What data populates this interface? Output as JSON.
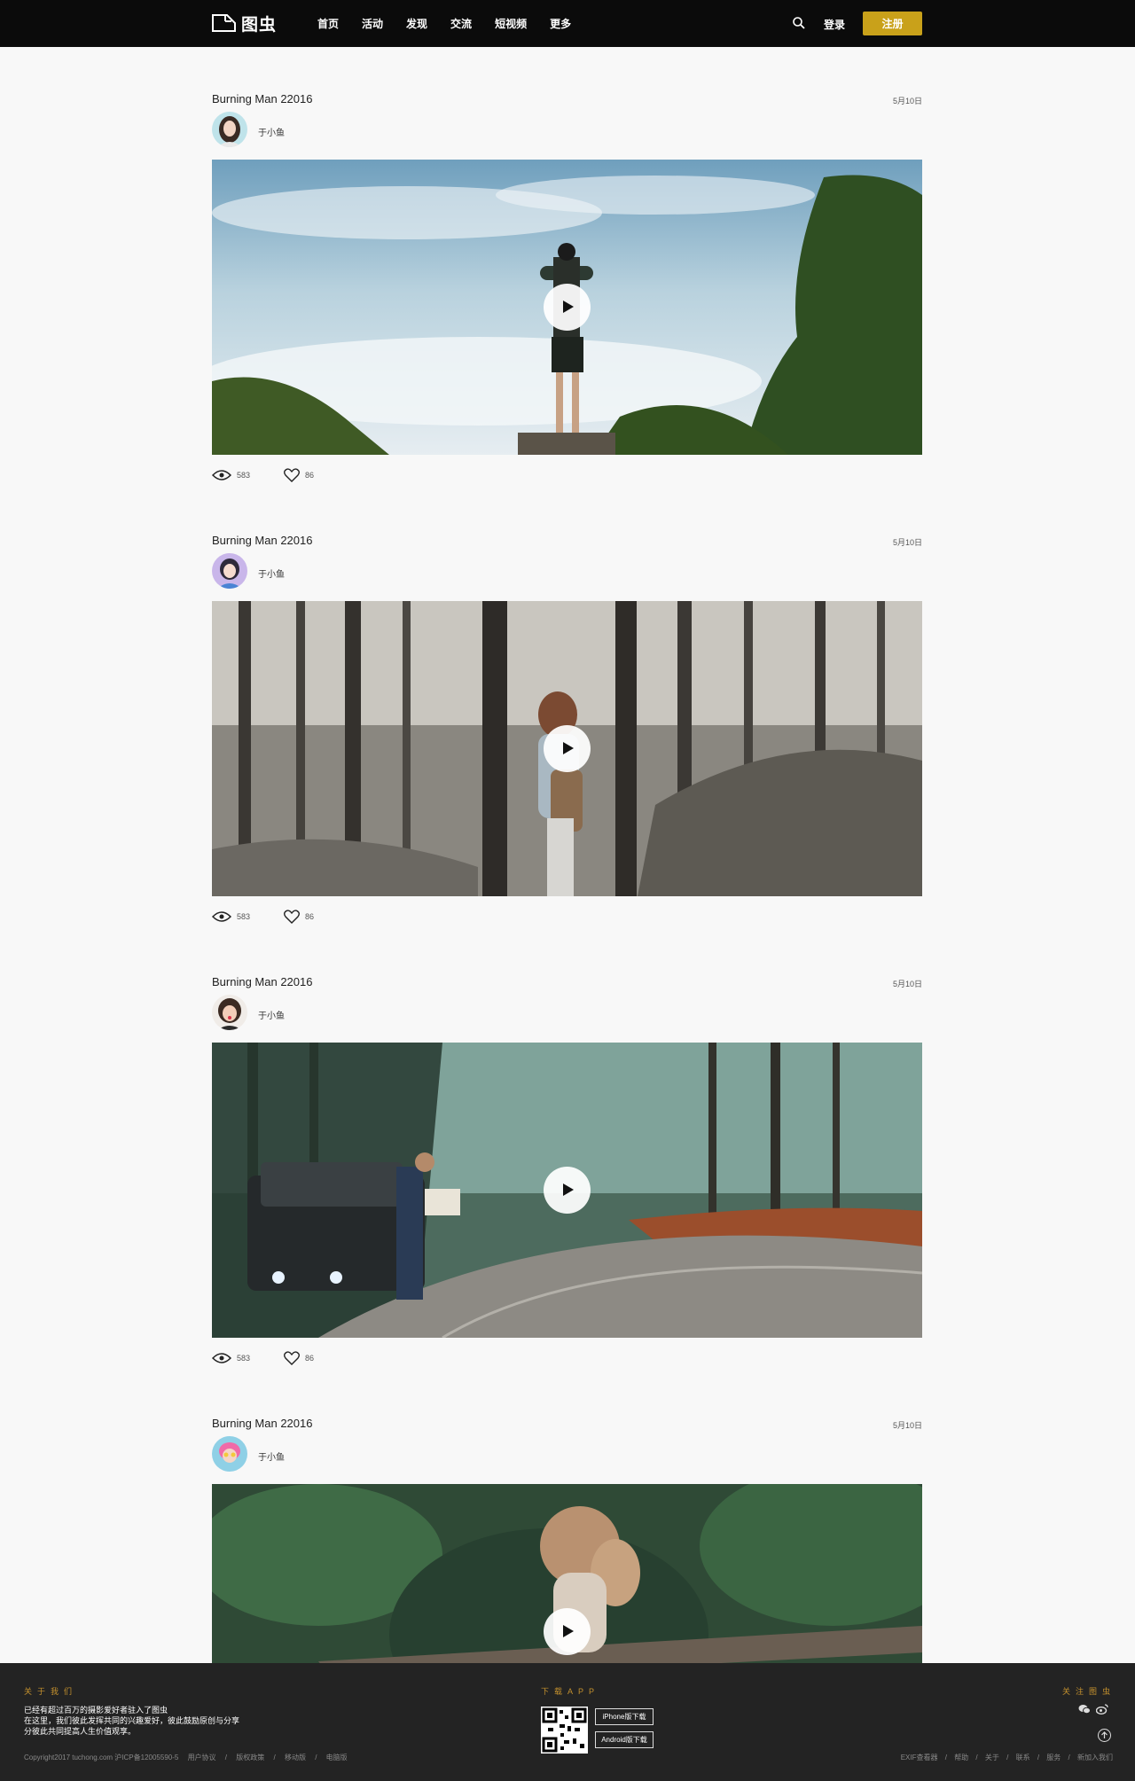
{
  "header": {
    "logo_text": "图虫",
    "nav": [
      "首页",
      "活动",
      "发现",
      "交流",
      "短视频",
      "更多"
    ],
    "login": "登录",
    "signup": "注册"
  },
  "posts": [
    {
      "title": "Burning Man 22016",
      "date": "5月10日",
      "author": "于小鱼",
      "views": "583",
      "likes": "86"
    },
    {
      "title": "Burning Man 22016",
      "date": "5月10日",
      "author": "于小鱼",
      "views": "583",
      "likes": "86"
    },
    {
      "title": "Burning Man 22016",
      "date": "5月10日",
      "author": "于小鱼",
      "views": "583",
      "likes": "86"
    },
    {
      "title": "Burning Man 22016",
      "date": "5月10日",
      "author": "于小鱼"
    }
  ],
  "footer": {
    "about_heading": "关于我们",
    "about_line1": "已经有超过百万的摄影爱好者驻入了图虫",
    "about_line2": "在这里，我们彼此发挥共同的兴趣爱好，彼此鼓励原创与分享",
    "about_line3": "分彼此共同提高人生价值观享。",
    "download_heading": "下载APP",
    "iphone_label": "iPhone版下载",
    "android_label": "Android版下载",
    "follow_heading": "关注图虫",
    "copyright": "Copyright2017 tuchong.com 沪ICP备12005590-5",
    "bottom_links": [
      "用户协议",
      "/",
      "版权政策",
      "/",
      "移动版",
      "/",
      "电脑版"
    ],
    "right_links": [
      "EXIF查看器",
      "/",
      "帮助",
      "/",
      "关于",
      "/",
      "联系",
      "/",
      "服务",
      "/",
      "新加入我们"
    ]
  }
}
